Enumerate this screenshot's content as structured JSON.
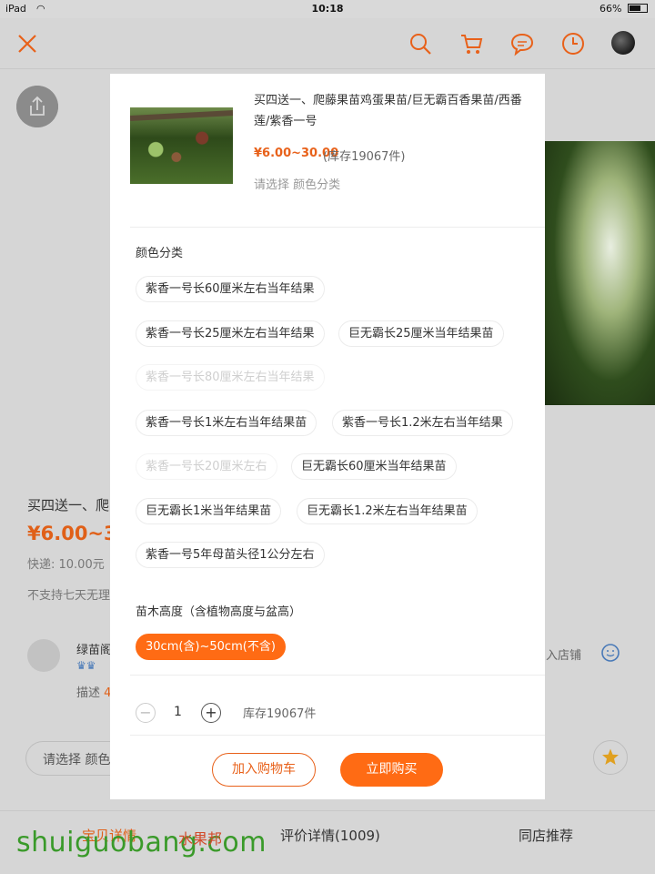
{
  "status_bar": {
    "device": "iPad",
    "time": "10:18",
    "battery": "66%"
  },
  "background_page": {
    "title_fragment": "买四送一、爬",
    "price_fragment": "¥6.00~3",
    "shipping": "快递: 10.00元",
    "no_return": "不支持七天无理",
    "shop_name_fragment": "绿苗阁",
    "desc_label": "描述",
    "desc_value_fragment": "4",
    "enter_shop_fragment": "入店铺",
    "select_hint_fragment": "请选择 颜色",
    "tabs": [
      "宝贝详情",
      "评价详情(1009)",
      "同店推荐"
    ]
  },
  "watermark": {
    "text": "shuiguobang.com",
    "small": "水果邦"
  },
  "sheet": {
    "product_title": "买四送一、爬藤果苗鸡蛋果苗/巨无霸百香果苗/西番莲/紫香一号",
    "price_range": "¥6.00~30.00",
    "stock_text": "(库存19067件)",
    "select_prompt": "请选择 颜色分类",
    "color_section_label": "颜色分类",
    "color_options": [
      {
        "label": "紫香一号长60厘米左右当年结果",
        "state": "normal"
      },
      {
        "label": "紫香一号长25厘米左右当年结果",
        "state": "normal"
      },
      {
        "label": "巨无霸长25厘米当年结果苗",
        "state": "normal"
      },
      {
        "label": "紫香一号长80厘米左右当年结果",
        "state": "disabled"
      },
      {
        "label": "紫香一号长1米左右当年结果苗",
        "state": "normal"
      },
      {
        "label": "紫香一号长1.2米左右当年结果",
        "state": "normal"
      },
      {
        "label": "紫香一号长20厘米左右",
        "state": "disabled"
      },
      {
        "label": "巨无霸长60厘米当年结果苗",
        "state": "normal"
      },
      {
        "label": "巨无霸长1米当年结果苗",
        "state": "normal"
      },
      {
        "label": "巨无霸长1.2米左右当年结果苗",
        "state": "normal"
      },
      {
        "label": "紫香一号5年母苗头径1公分左右",
        "state": "normal"
      }
    ],
    "height_section_label": "苗木高度（含植物高度与盆高）",
    "height_option": "30cm(含)~50cm(不含)",
    "quantity": {
      "minus": "−",
      "value": "1",
      "plus": "+",
      "stock": "库存19067件"
    },
    "add_to_cart": "加入购物车",
    "buy_now": "立即购买"
  },
  "colors": {
    "accent": "#ff6b14",
    "price": "#e8611a",
    "overlay_bg": "#d6d6d6"
  },
  "icons": [
    "close-icon",
    "search-icon",
    "cart-icon",
    "chat-icon",
    "history-icon",
    "share-icon",
    "star-icon",
    "smile-icon"
  ]
}
